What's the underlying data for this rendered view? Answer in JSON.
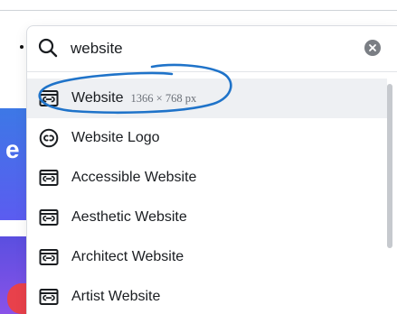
{
  "search": {
    "value": "website",
    "icon": "search-icon",
    "clear_icon": "close-icon"
  },
  "results": [
    {
      "label": "Website",
      "meta": "1366 × 768 px",
      "icon": "website-layout-icon",
      "selected": true
    },
    {
      "label": "Website Logo",
      "meta": "",
      "icon": "logo-icon",
      "selected": false
    },
    {
      "label": "Accessible Website",
      "meta": "",
      "icon": "website-layout-icon",
      "selected": false
    },
    {
      "label": "Aesthetic Website",
      "meta": "",
      "icon": "website-layout-icon",
      "selected": false
    },
    {
      "label": "Architect Website",
      "meta": "",
      "icon": "website-layout-icon",
      "selected": false
    },
    {
      "label": "Artist Website",
      "meta": "",
      "icon": "website-layout-icon",
      "selected": false
    }
  ],
  "background": {
    "partial_text": "e"
  },
  "colors": {
    "selected_row": "#eef0f3",
    "annotation": "#1f73c9",
    "text": "#1a1d21"
  }
}
